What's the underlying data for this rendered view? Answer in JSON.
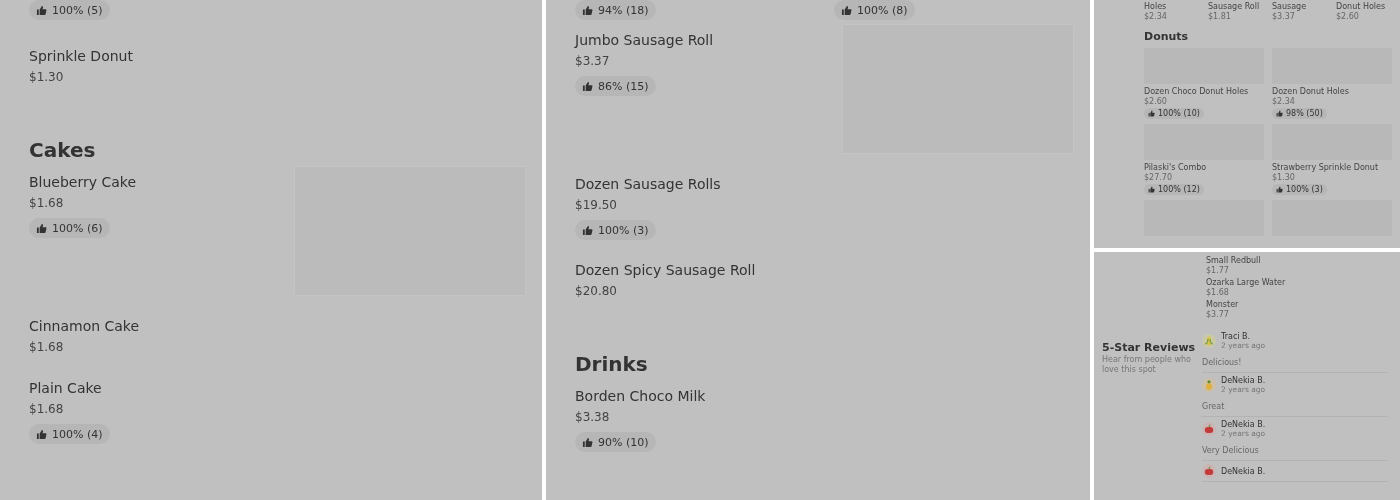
{
  "left_panel": {
    "blocks": [
      {
        "kind": "rating",
        "rating": "100% (5)"
      },
      {
        "kind": "item",
        "name": "Sprinkle Donut",
        "price": "$1.30"
      },
      {
        "kind": "heading",
        "text": "Cakes"
      },
      {
        "kind": "item",
        "name": "Blueberry Cake",
        "price": "$1.68",
        "rating": "100% (6)",
        "image": true
      },
      {
        "kind": "item",
        "name": "Cinnamon Cake",
        "price": "$1.68"
      },
      {
        "kind": "item",
        "name": "Plain Cake",
        "price": "$1.68",
        "rating": "100% (4)"
      }
    ]
  },
  "middle_panel": {
    "blocks": [
      {
        "kind": "rating-pair",
        "ratings": [
          "94% (18)",
          "100% (8)"
        ]
      },
      {
        "kind": "item",
        "name": "Jumbo Sausage Roll",
        "price": "$3.37",
        "rating": "86% (15)",
        "image": true
      },
      {
        "kind": "item",
        "name": "Dozen Sausage Rolls",
        "price": "$19.50",
        "rating": "100% (3)"
      },
      {
        "kind": "item",
        "name": "Dozen Spicy Sausage Roll",
        "price": "$20.80"
      },
      {
        "kind": "heading",
        "text": "Drinks"
      },
      {
        "kind": "item",
        "name": "Borden Choco Milk",
        "price": "$3.38",
        "rating": "90% (10)"
      }
    ]
  },
  "grid_panel": {
    "top_items": [
      {
        "name": "Holes",
        "price": "$2.34"
      },
      {
        "name": "Sausage Roll",
        "price": "$1.81"
      },
      {
        "name": "Sausage",
        "price": "$3.37"
      },
      {
        "name": "Donut Holes",
        "price": "$2.60"
      }
    ],
    "heading": "Donuts",
    "cards": [
      {
        "kind": "card",
        "name": "Dozen Choco Donut Holes",
        "price": "$2.60",
        "rating": "100% (10)"
      },
      {
        "kind": "card",
        "name": "Dozen Donut Holes",
        "price": "$2.34",
        "rating": "98% (50)"
      },
      {
        "kind": "card",
        "name": "Pilaski's Combo",
        "price": "$27.70",
        "rating": "100% (12)"
      },
      {
        "kind": "card",
        "name": "Strawberry Sprinkle Donut",
        "price": "$1.30",
        "rating": "100% (3)"
      },
      {
        "kind": "image-only"
      },
      {
        "kind": "image-only"
      }
    ]
  },
  "reviews_panel": {
    "items": [
      {
        "name": "Small Redbull",
        "price": "$1.77"
      },
      {
        "name": "Ozarka Large Water",
        "price": "$1.68"
      },
      {
        "name": "Monster",
        "price": "$3.77"
      }
    ],
    "title": "5-Star Reviews",
    "subtitle": "Hear from people who love this spot",
    "reviews": [
      {
        "kind": "corn",
        "name": "Traci B.",
        "time": "2 years ago",
        "text": "Delicious!"
      },
      {
        "kind": "pineapple",
        "name": "DeNekia B.",
        "time": "2 years ago",
        "text": "Great"
      },
      {
        "kind": "apple",
        "name": "DeNekia B.",
        "time": "2 years ago",
        "text": "Very Delicious"
      },
      {
        "kind": "apple",
        "name": "DeNekia B."
      }
    ]
  }
}
